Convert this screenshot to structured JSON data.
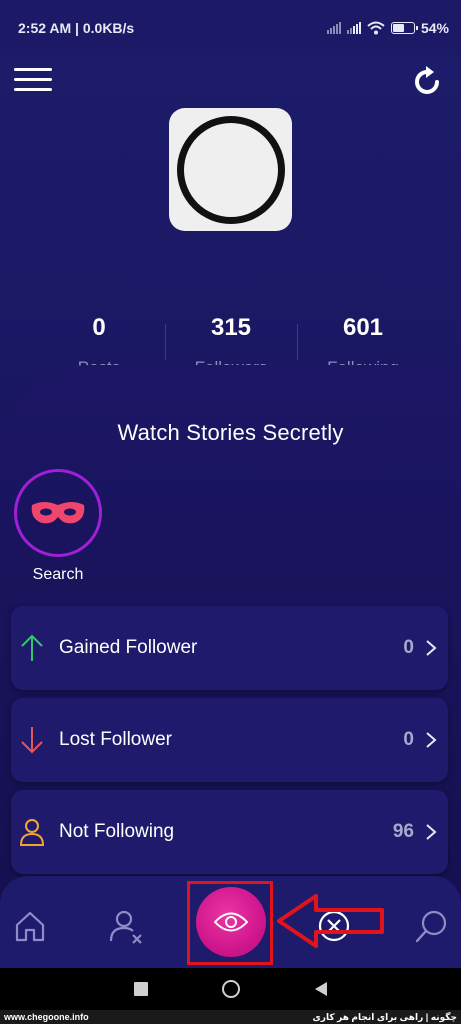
{
  "status_bar": {
    "time_speed": "2:52 AM | 0.0KB/s",
    "battery": "54%",
    "battery_level": 0.54
  },
  "header": {
    "menu_icon": "hamburger-icon",
    "refresh_icon": "refresh-icon"
  },
  "profile": {
    "stats": [
      {
        "value": "0",
        "label": "Posts"
      },
      {
        "value": "315",
        "label": "Followers"
      },
      {
        "value": "601",
        "label": "Following"
      }
    ]
  },
  "main": {
    "title": "Watch Stories Secretly",
    "search_label": "Search",
    "cards": [
      {
        "label": "Gained Follower",
        "count": "0",
        "icon": "arrow-up-icon",
        "color": "#35c46e"
      },
      {
        "label": "Lost Follower",
        "count": "0",
        "icon": "arrow-down-icon",
        "color": "#e8555a"
      },
      {
        "label": "Not Following",
        "count": "96",
        "icon": "user-icon",
        "color": "#f0a431"
      }
    ]
  },
  "bottom_nav": {
    "items": [
      "home-icon",
      "remove-user-icon",
      "eye-icon",
      "circle-x-icon",
      "search-icon"
    ]
  },
  "footer": {
    "left": "www.chegoone.info",
    "right": "چگونه | راهی برای انجام هر کاری"
  },
  "colors": {
    "accent": "#d0168c",
    "highlight": "#e1141c",
    "background": "#1a1660"
  }
}
